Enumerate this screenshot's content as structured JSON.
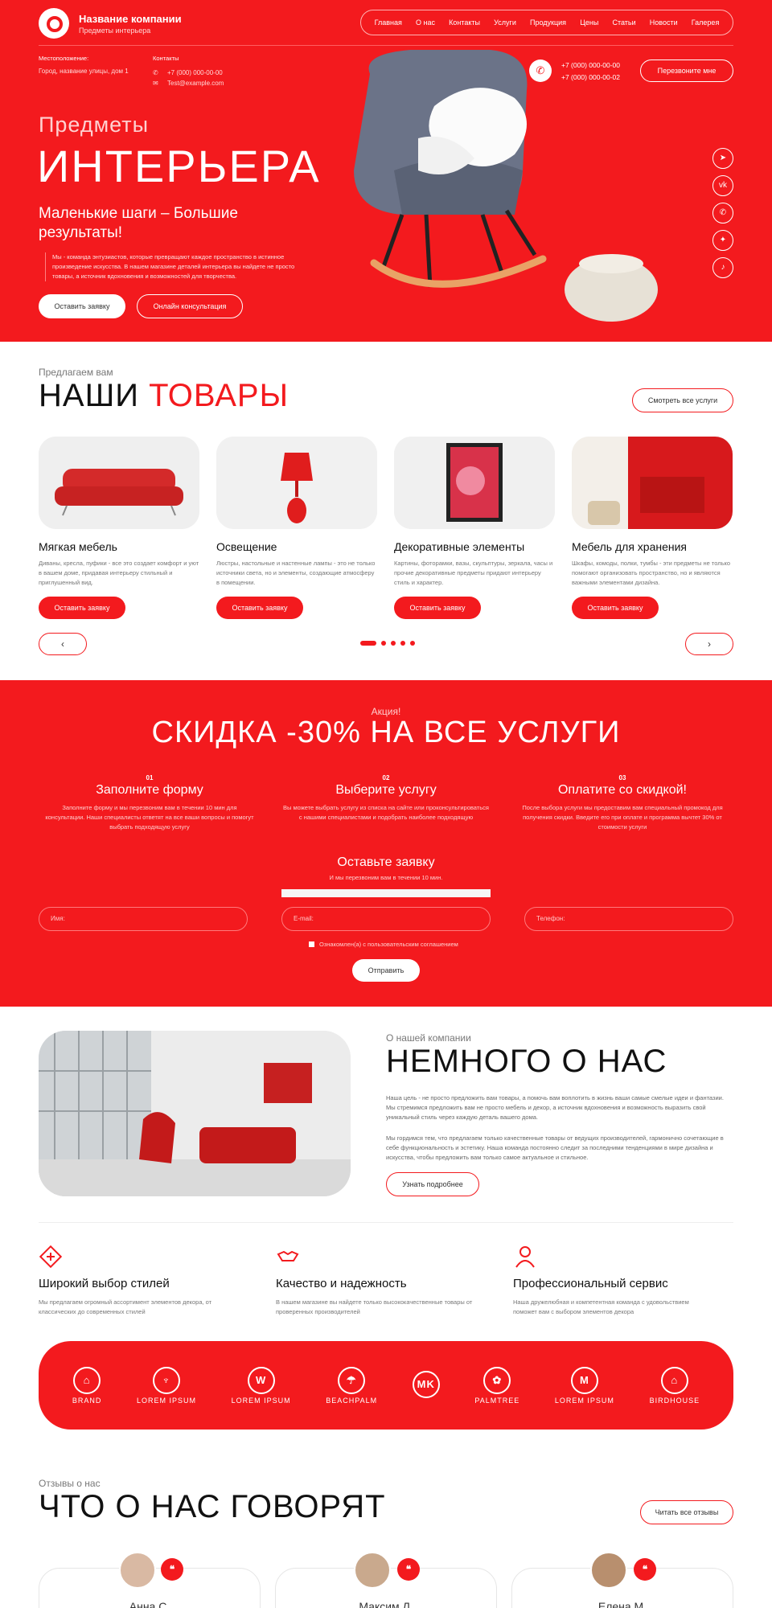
{
  "header": {
    "company_name": "Название компании",
    "company_sub": "Предметы интерьера",
    "nav": [
      "Главная",
      "О нас",
      "Контакты",
      "Услуги",
      "Продукция",
      "Цены",
      "Статьи",
      "Новости",
      "Галерея"
    ],
    "location_label": "Местоположение:",
    "location_value": "Город, название улицы, дом 1",
    "contacts_label": "Контакты",
    "contact_phone": "+7 (000) 000-00-00",
    "contact_email": "Test@example.com",
    "phone_1": "+7 (000) 000-00-00",
    "phone_2": "+7 (000) 000-00-02",
    "call_button": "Перезвоните мне"
  },
  "hero": {
    "pre_title": "Предметы",
    "title": "ИНТЕРЬЕРА",
    "subtitle": "Маленькие шаги – Большие результаты!",
    "description": "Мы - команда энтузиастов, которые превращают каждое пространство в истинное произведение искусства. В нашем магазине деталей интерьера вы найдете не просто товары, а источник вдохновения и возможностей для творчества.",
    "button_primary": "Оставить заявку",
    "button_secondary": "Онлайн консультация",
    "social": [
      "telegram-icon",
      "vk-icon",
      "whatsapp-icon",
      "twitter-icon",
      "bell-icon"
    ]
  },
  "products": {
    "pre_title": "Предлагаем вам",
    "title_black": "НАШИ",
    "title_red": "ТОВАРЫ",
    "all_button": "Смотреть все услуги",
    "cards": [
      {
        "title": "Мягкая мебель",
        "text": "Диваны, кресла, пуфики - все это создает комфорт и уют в вашем доме, придавая интерьеру стильный и приглушенный вид.",
        "button": "Оставить заявку"
      },
      {
        "title": "Освещение",
        "text": "Люстры, настольные и настенные лампы - это не только источники света, но и элементы, создающие атмосферу в помещении.",
        "button": "Оставить заявку"
      },
      {
        "title": "Декоративные элементы",
        "text": "Картины, фоторамки, вазы, скульптуры, зеркала, часы и прочие декоративные предметы придают интерьеру стиль и характер.",
        "button": "Оставить заявку"
      },
      {
        "title": "Мебель для хранения",
        "text": "Шкафы, комоды, полки, тумбы - эти предметы не только помогают организовать пространство, но и являются важными элементами дизайна.",
        "button": "Оставить заявку"
      }
    ],
    "prev": "‹",
    "next": "›"
  },
  "promo": {
    "pre_title": "Акция!",
    "title": "СКИДКА -30% НА ВСЕ УСЛУГИ",
    "steps": [
      {
        "num": "01",
        "title": "Заполните форму",
        "text": "Заполните форму и мы перезвоним вам в течении 10 мин для консультации. Наши специалисты ответят на все ваши вопросы и помогут выбрать подходящую услугу"
      },
      {
        "num": "02",
        "title": "Выберите услугу",
        "text": "Вы можете выбрать услугу из списка на сайте или проконсультироваться с нашими специалистами и подобрать наиболее подходящую"
      },
      {
        "num": "03",
        "title": "Оплатите со скидкой!",
        "text": "После выбора услуги мы предоставим вам специальный промокод для получения скидки. Введите его при оплате и программа вычтет 30% от стоимости услуги"
      }
    ],
    "form_title": "Оставьте заявку",
    "form_sub": "И мы перезвоним вам в течении 10 мин.",
    "placeholder_name": "Имя:",
    "placeholder_email": "E-mail:",
    "placeholder_phone": "Телефон:",
    "agree": "Ознакомлен(а) с пользовательским соглашением",
    "submit": "Отправить"
  },
  "about": {
    "pre_title": "О нашей компании",
    "title": "НЕМНОГО О НАС",
    "p1": "Наша цель - не просто предложить вам товары, а помочь вам воплотить в жизнь ваши самые смелые идеи и фантазии. Мы стремимся предложить вам не просто мебель и декор, а источник вдохновения и возможность выразить свой уникальный стиль через каждую деталь вашего дома.",
    "p2": "Мы гордимся тем, что предлагаем только качественные товары от ведущих производителей, гармонично сочетающие в себе функциональность и эстетику. Наша команда постоянно следит за последними тенденциями в мире дизайна и искусства, чтобы предложить вам только самое актуальное и стильное.",
    "button": "Узнать подробнее"
  },
  "features": [
    {
      "icon": "styles-icon",
      "title": "Широкий выбор стилей",
      "text": "Мы предлагаем огромный ассортимент элементов декора, от классических до современных стилей"
    },
    {
      "icon": "handshake-icon",
      "title": "Качество и надежность",
      "text": "В нашем магазине вы найдете только высококачественные товары от проверенных производителей"
    },
    {
      "icon": "specialist-icon",
      "title": "Профессиональный сервис",
      "text": "Наша дружелюбная и компетентная команда с удовольствием поможет вам с выбором элементов декора"
    }
  ],
  "brands": [
    {
      "mark": "⌂",
      "name": "BRAND"
    },
    {
      "mark": "♆",
      "name": "LOREM IPSUM"
    },
    {
      "mark": "W",
      "name": "LOREM IPSUM"
    },
    {
      "mark": "☂",
      "name": "BEACHPALM"
    },
    {
      "mark": "MK",
      "name": ""
    },
    {
      "mark": "✿",
      "name": "PALMTREE"
    },
    {
      "mark": "M",
      "name": "LOREM IPSUM"
    },
    {
      "mark": "⌂",
      "name": "BIRDHOUSE"
    }
  ],
  "reviews": {
    "pre_title": "Отзывы о нас",
    "title": "ЧТО О НАС ГОВОРЯТ",
    "all_button": "Читать все отзывы",
    "items": [
      {
        "name": "Анна С."
      },
      {
        "name": "Максим Л."
      },
      {
        "name": "Елена М."
      }
    ]
  },
  "colors": {
    "accent": "#f31a1e",
    "white": "#ffffff",
    "text": "#222222"
  }
}
